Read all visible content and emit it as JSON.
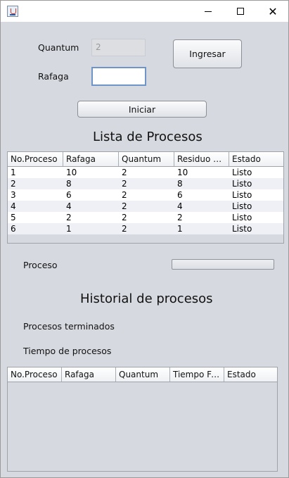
{
  "window": {
    "icon": "java-cup-icon",
    "controls": {
      "minimize": "minimize-icon",
      "maximize": "maximize-icon",
      "close": "✕"
    }
  },
  "form": {
    "quantum_label": "Quantum",
    "quantum_value": "2",
    "rafaga_label": "Rafaga",
    "rafaga_value": "",
    "ingresar_label": "Ingresar",
    "iniciar_label": "Iniciar"
  },
  "process_list": {
    "title": "Lista de Procesos",
    "columns": [
      "No.Proceso",
      "Rafaga",
      "Quantum",
      "Residuo R...",
      "Estado"
    ],
    "rows": [
      [
        "1",
        "10",
        "2",
        "10",
        "Listo"
      ],
      [
        "2",
        "8",
        "2",
        "8",
        "Listo"
      ],
      [
        "3",
        "6",
        "2",
        "6",
        "Listo"
      ],
      [
        "4",
        "4",
        "2",
        "4",
        "Listo"
      ],
      [
        "5",
        "2",
        "2",
        "2",
        "Listo"
      ],
      [
        "6",
        "1",
        "2",
        "1",
        "Listo"
      ]
    ]
  },
  "progress": {
    "label": "Proceso",
    "value": 0
  },
  "history": {
    "title": "Historial de procesos",
    "finished_label": "Procesos terminados",
    "time_label": "Tiempo de procesos",
    "columns": [
      "No.Proceso",
      "Rafaga",
      "Quantum",
      "Tiempo Fi...",
      "Estado"
    ],
    "rows": []
  }
}
